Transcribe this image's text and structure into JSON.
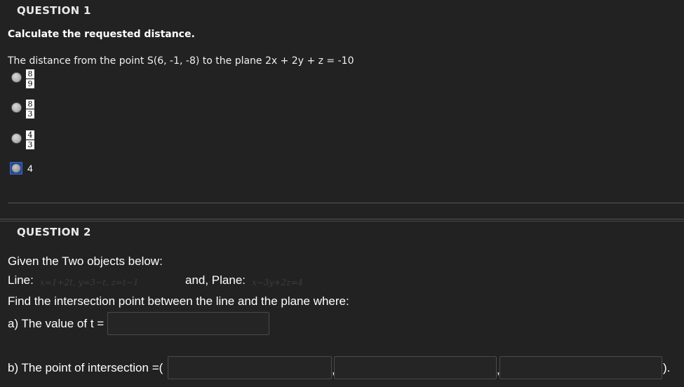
{
  "q1": {
    "header": "QUESTION 1",
    "instruction": "Calculate the requested distance.",
    "question": "The distance from the point S(6, -1, -8) to the plane 2x + 2y + z = -10",
    "choices": [
      {
        "type": "fraction",
        "num": "8",
        "den": "9"
      },
      {
        "type": "fraction",
        "num": "8",
        "den": "3"
      },
      {
        "type": "fraction",
        "num": "4",
        "den": "3"
      },
      {
        "type": "text",
        "text": "4",
        "selected": true
      }
    ]
  },
  "q2": {
    "header": "QUESTION 2",
    "intro": "Given the Two objects below:",
    "line_label": "Line:",
    "line_eq": "x=1+2t, y=3−t, z=t−1",
    "and_plane": "and, Plane:",
    "plane_eq": "x−3y+2z=4",
    "find": "Find the intersection point between the line and the plane where:",
    "part_a": "a) The value of t =",
    "part_a_value": "",
    "part_b": "b) The point of intersection =(",
    "part_b_values": [
      "",
      "",
      ""
    ],
    "comma": ",",
    "close": ")."
  }
}
